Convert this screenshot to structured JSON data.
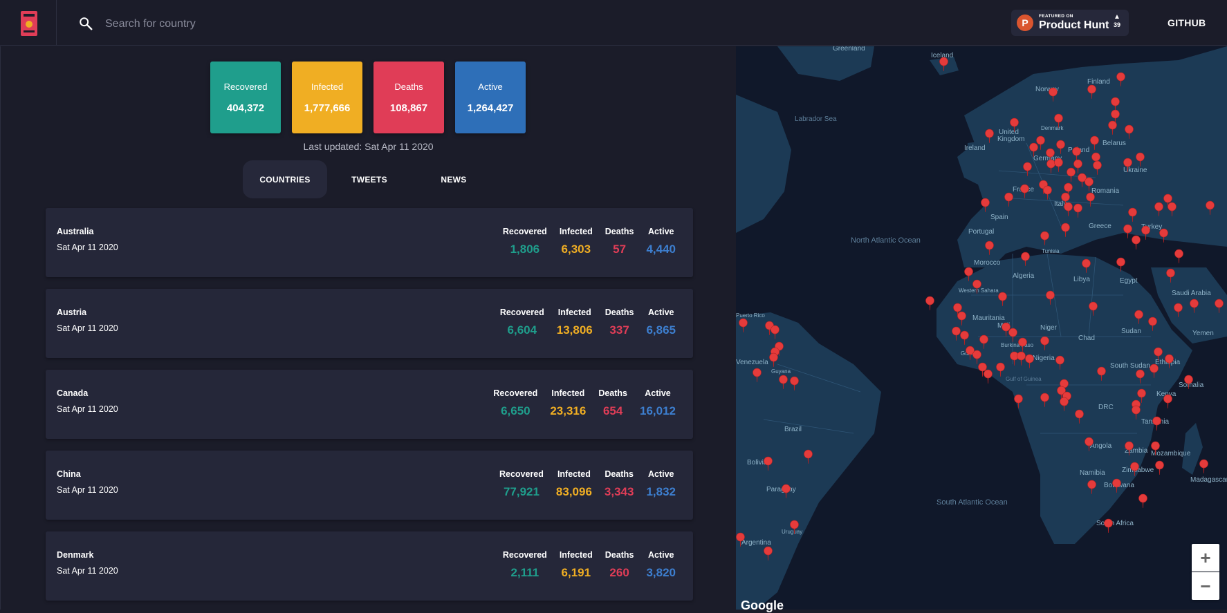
{
  "search": {
    "placeholder": "Search for country"
  },
  "product_hunt": {
    "small": "FEATURED ON",
    "big": "Product Hunt",
    "votes": "39",
    "logo_letter": "P"
  },
  "github": {
    "label": "GITHUB"
  },
  "summary": [
    {
      "label": "Recovered",
      "value": "404,372",
      "color": "#1f9e8c"
    },
    {
      "label": "Infected",
      "value": "1,777,666",
      "color": "#f0ae23"
    },
    {
      "label": "Deaths",
      "value": "108,867",
      "color": "#e03d57"
    },
    {
      "label": "Active",
      "value": "1,264,427",
      "color": "#2e6fb8"
    }
  ],
  "last_updated": "Last updated: Sat Apr 11 2020",
  "tabs": [
    {
      "label": "COUNTRIES",
      "active": true
    },
    {
      "label": "TWEETS",
      "active": false
    },
    {
      "label": "NEWS",
      "active": false
    }
  ],
  "stat_labels": {
    "recovered": "Recovered",
    "infected": "Infected",
    "deaths": "Deaths",
    "active": "Active"
  },
  "stat_colors": {
    "recovered": "#1f9e8c",
    "infected": "#f0ae23",
    "deaths": "#e03d57",
    "active": "#3d7fd0"
  },
  "countries": [
    {
      "name": "Australia",
      "date": "Sat Apr 11 2020",
      "recovered": "1,806",
      "infected": "6,303",
      "deaths": "57",
      "active": "4,440"
    },
    {
      "name": "Austria",
      "date": "Sat Apr 11 2020",
      "recovered": "6,604",
      "infected": "13,806",
      "deaths": "337",
      "active": "6,865"
    },
    {
      "name": "Canada",
      "date": "Sat Apr 11 2020",
      "recovered": "6,650",
      "infected": "23,316",
      "deaths": "654",
      "active": "16,012"
    },
    {
      "name": "China",
      "date": "Sat Apr 11 2020",
      "recovered": "77,921",
      "infected": "83,096",
      "deaths": "3,343",
      "active": "1,832"
    },
    {
      "name": "Denmark",
      "date": "Sat Apr 11 2020",
      "recovered": "2,111",
      "infected": "6,191",
      "deaths": "260",
      "active": "3,820"
    }
  ],
  "map": {
    "labels": [
      "Greenland",
      "Iceland",
      "Labrador Sea",
      "Norway",
      "Finland",
      "United Kingdom",
      "Denmark",
      "Belarus",
      "Ireland",
      "Poland",
      "Germany",
      "Ukraine",
      "France",
      "Romania",
      "Spain",
      "Portugal",
      "Turkey",
      "Italy",
      "Greece",
      "North Atlantic Ocean",
      "Morocco",
      "Tunisia",
      "Algeria",
      "Libya",
      "Egypt",
      "Saudi Arabia",
      "Western Sahara",
      "Mauritania",
      "Mali",
      "Niger",
      "Chad",
      "Sudan",
      "Yemen",
      "Puerto Rico",
      "Venezuela",
      "Guyana",
      "Nigeria",
      "South Sudan",
      "Ethiopia",
      "Burkina Faso",
      "Guinea",
      "Gulf of Guinea",
      "Somalia",
      "Kenya",
      "DRC",
      "Tanzania",
      "Brazil",
      "Angola",
      "Zambia",
      "Mozambique",
      "Bolivia",
      "Namibia",
      "Zimbabwe",
      "Madagascar",
      "Botswana",
      "Paraguay",
      "South Atlantic Ocean",
      "South Africa",
      "Argentina",
      "Uruguay",
      "Google"
    ],
    "zoom_in": "+",
    "zoom_out": "−"
  }
}
